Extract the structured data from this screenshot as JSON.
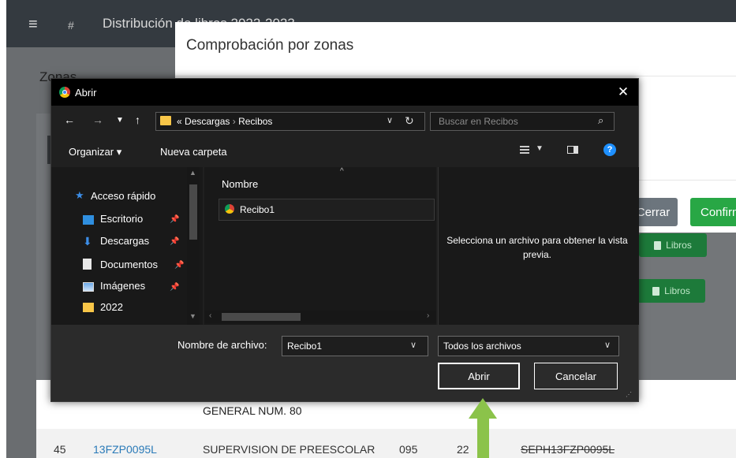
{
  "app": {
    "title": "Distribución de libros 2022-2023",
    "menu_icon": "hamburger-icon",
    "grid_icon": "grid-icon"
  },
  "zonas": {
    "label": "Zonas"
  },
  "modal": {
    "title": "Comprobación por zonas",
    "close_label": "Cerrar",
    "confirm_label": "Confirmar"
  },
  "libros": {
    "label": "Libros"
  },
  "table": {
    "partial_text": "GENERAL NUM. 80",
    "row": {
      "num": "45",
      "code": "13FZP0095L",
      "name": "SUPERVISION DE PREESCOLAR",
      "zone": "095",
      "count": "22",
      "clave": "SEPH13FZP0095L"
    }
  },
  "dialog": {
    "title": "Abrir",
    "close_icon": "close-icon",
    "address": {
      "prefix": "«",
      "segments": [
        "Descargas",
        "Recibos"
      ],
      "separator": "›"
    },
    "search_placeholder": "Buscar en Recibos",
    "toolbar": {
      "organize": "Organizar ▾",
      "new_folder": "Nueva carpeta",
      "help": "?"
    },
    "nav": {
      "quick_access": "Acceso rápido",
      "items": [
        {
          "label": "Escritorio",
          "icon": "desktop-icon",
          "pinned": true
        },
        {
          "label": "Descargas",
          "icon": "download-icon",
          "pinned": true
        },
        {
          "label": "Documentos",
          "icon": "document-icon",
          "pinned": true
        },
        {
          "label": "Imágenes",
          "icon": "images-icon",
          "pinned": true
        },
        {
          "label": "2022",
          "icon": "folder-icon",
          "pinned": false
        }
      ]
    },
    "files": {
      "column_name": "Nombre",
      "items": [
        {
          "name": "Recibo1",
          "icon": "chrome-icon"
        }
      ]
    },
    "preview_text": "Selecciona un archivo para obtener la vista previa.",
    "filename_label": "Nombre de archivo:",
    "filename_value": "Recibo1",
    "filetype_value": "Todos los archivos",
    "open_label": "Abrir",
    "cancel_label": "Cancelar"
  },
  "colors": {
    "app_bar": "#343a40",
    "success_green": "#28a745",
    "secondary_gray": "#6c757d",
    "link_blue": "#2a7ab8",
    "arrow_green": "#8bc34a",
    "dialog_bg": "#202020"
  }
}
